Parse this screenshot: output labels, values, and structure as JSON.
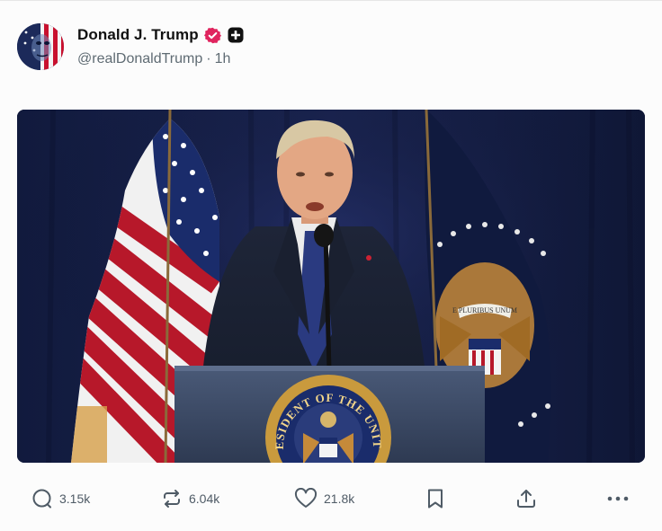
{
  "author": {
    "display_name": "Donald J. Trump",
    "handle": "@realDonaldTrump",
    "separator": "·",
    "time_ago": "1h",
    "verified_color": "#e0245e"
  },
  "post": {
    "media": {
      "image_icon": "photo-of-speaker-at-podium",
      "seal_text_top": "PRESIDENT OF THE UNITED",
      "flag_scroll_text": "E PLURIBUS UNUM"
    }
  },
  "actions": {
    "reply_count": "3.15k",
    "repost_count": "6.04k",
    "like_count": "21.8k",
    "bookmark_icon": "bookmark-icon",
    "share_icon": "share-icon",
    "more_icon": "more-icon"
  },
  "colors": {
    "icon_gray": "#4f5b66",
    "handle_gray": "#5f6b73"
  }
}
